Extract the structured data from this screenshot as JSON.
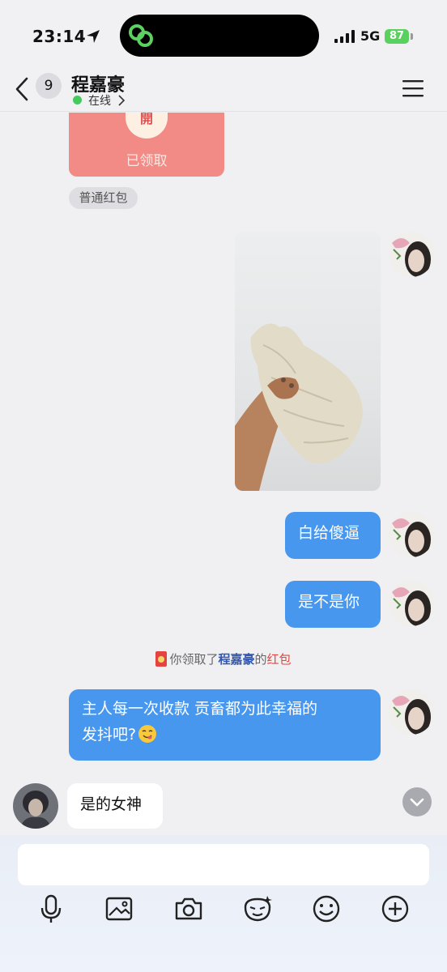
{
  "status_bar": {
    "time": "23:14",
    "network": "5G",
    "battery": "87"
  },
  "nav": {
    "unread_count": "9",
    "contact_name": "程嘉豪",
    "online_status": "在线"
  },
  "messages": {
    "red_packet": {
      "char": "開",
      "status": "已领取",
      "tag": "普通红包"
    },
    "outgoing_1": "白给傻逼",
    "outgoing_2": "是不是你",
    "system_notice": {
      "prefix": "你领取了",
      "name": "程嘉豪",
      "middle": "的",
      "suffix": "红包"
    },
    "outgoing_3_line1": "主人每一次收款 贡畜都为此幸福的",
    "outgoing_3_line2": "发抖吧?",
    "incoming_1": "是的女神"
  },
  "toolbar": {
    "icons": [
      "microphone-icon",
      "image-icon",
      "camera-icon",
      "sticker-icon",
      "emoji-icon",
      "plus-icon"
    ]
  },
  "colors": {
    "out_bubble": "#4797ef",
    "red_packet": "#f28b85",
    "online": "#47c95e",
    "battery": "#5ad15f"
  }
}
